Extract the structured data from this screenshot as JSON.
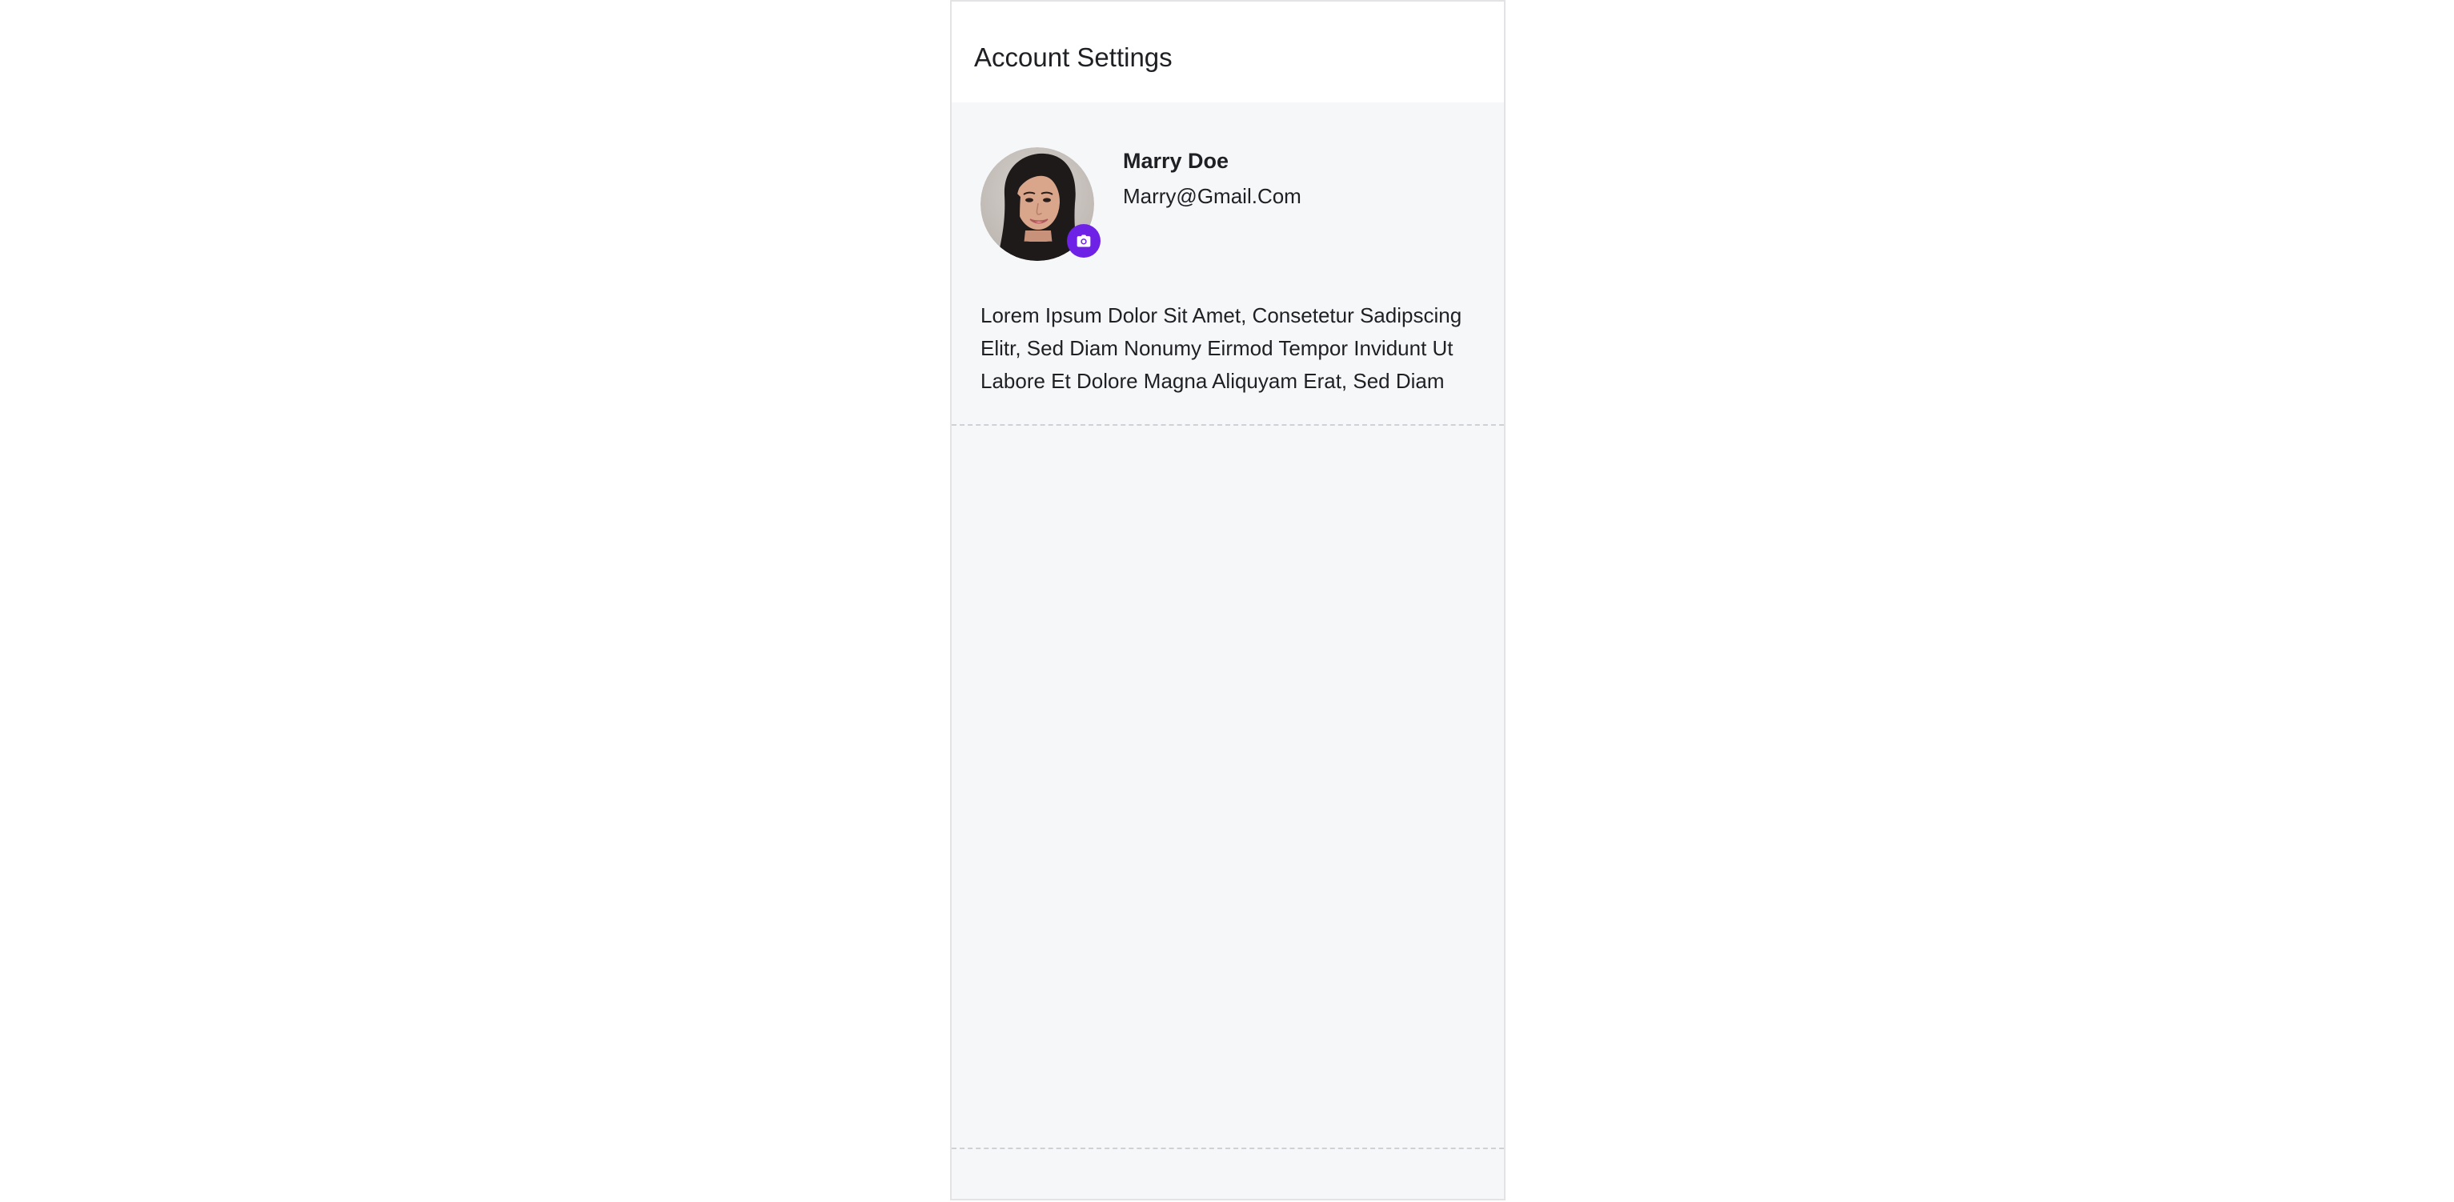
{
  "header": {
    "title": "Account Settings"
  },
  "profile": {
    "name": "Marry Doe",
    "email": "Marry@Gmail.Com",
    "avatar_icon": "user-avatar-photo",
    "camera_icon": "camera-icon",
    "bio": "Lorem Ipsum Dolor Sit Amet, Consetetur Sadipscing Elitr, Sed Diam Nonumy Eirmod Tempor Invidunt Ut Labore Et Dolore Magna Aliquyam Erat, Sed Diam"
  },
  "colors": {
    "accent": "#6e22e6",
    "panel_background": "#f6f7f9",
    "header_background": "#ffffff",
    "text": "#1f2024",
    "divider": "#cfd1d6"
  }
}
